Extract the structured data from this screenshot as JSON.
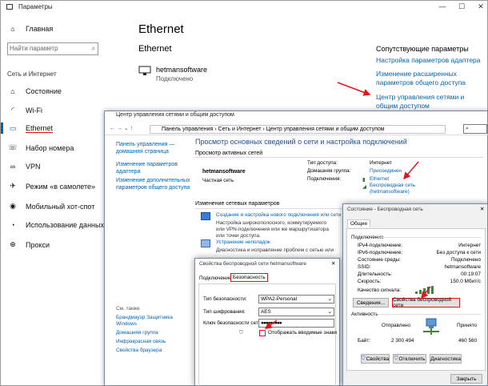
{
  "settings": {
    "title": "Параметры",
    "search_placeholder": "Найти параметр",
    "home_label": "Главная",
    "section": "Сеть и Интернет",
    "nav": [
      "Состояние",
      "Wi-Fi",
      "Ethernet",
      "Набор номера",
      "VPN",
      "Режим «в самолете»",
      "Мобильный хот-спот",
      "Использование данных",
      "Прокси"
    ],
    "page_title": "Ethernet",
    "page_subtitle": "Ethernet",
    "adapter_name": "hetmansoftware",
    "adapter_status": "Подключено",
    "related_title": "Сопутствующие параметры",
    "related_links": [
      "Настройка параметров адаптера",
      "Изменение расширенных параметров общего доступа",
      "Центр управления сетями и общим доступом"
    ]
  },
  "cp": {
    "title": "Центр управления сетями и общим доступом",
    "breadcrumb": [
      "Панель управления",
      "Сеть и Интернет",
      "Центр управления сетями и общим доступом"
    ],
    "sidebar": [
      "Панель управления — домашняя страница",
      "Изменение параметров адаптера",
      "Изменение дополнительных параметров общего доступа"
    ],
    "see_also_title": "См. также",
    "see_also": [
      "Брандмауэр Защитника Windows",
      "Домашняя группа",
      "Инфракрасная связь",
      "Свойства браузера"
    ],
    "heading": "Просмотр основных сведений о сети и настройка подключений",
    "active_title": "Просмотр активных сетей",
    "network_name": "hetmansoftware",
    "network_type": "Частная сеть",
    "access_type_label": "Тип доступа:",
    "access_type": "Интернет",
    "homegroup_label": "Домашняя группа:",
    "homegroup": "Присоединен",
    "connections_label": "Подключения:",
    "conn1": "Ethernet",
    "conn2": "Беспроводная сеть (hetmansoftware)",
    "change_title": "Изменение сетевых параметров",
    "task1": "Создание и настройка нового подключения или сети",
    "task1_desc": "Настройка широкополосного, коммутируемого или VPN-подключения или же маршрутизатора или точки доступа.",
    "task2": "Устранение неполадок",
    "task2_desc": "Диагностика и исправление проблем с сетью или получение сведений об"
  },
  "props": {
    "title": "Свойства беспроводной сети hetmansoftware",
    "tab1": "Подключение",
    "tab2": "Безопасность",
    "sec_type_label": "Тип безопасности:",
    "sec_type": "WPA2-Personal",
    "enc_label": "Тип шифрования:",
    "enc": "AES",
    "key_label": "Ключ безопасности сети",
    "key": "●●●●●●●●●",
    "show_chars": "Отображать вводимые знаки"
  },
  "status": {
    "title": "Состояние - Беспроводная сеть",
    "tab": "Общие",
    "group1": "Подключение",
    "rows": [
      {
        "k": "IPv4-подключение:",
        "v": "Интернет"
      },
      {
        "k": "IPv6-подключение:",
        "v": "Без доступа к сети"
      },
      {
        "k": "Состояние среды:",
        "v": "Подключено"
      },
      {
        "k": "SSID:",
        "v": "hetmansoftware"
      },
      {
        "k": "Длительность:",
        "v": "00:19:07"
      },
      {
        "k": "Скорость:",
        "v": "150.0 Мбит/с"
      }
    ],
    "quality_label": "Качество сигнала:",
    "details_btn": "Сведения...",
    "wprops_btn": "Свойства беспроводной сети",
    "group2": "Активность",
    "sent": "Отправлено",
    "received": "Принято",
    "bytes_label": "Байт:",
    "bytes_sent": "2 300 494",
    "bytes_recv": "460 560",
    "props_btn": "Свойства",
    "disconnect_btn": "Отключить",
    "diag_btn": "Диагностика",
    "close_btn": "Закрыть"
  }
}
